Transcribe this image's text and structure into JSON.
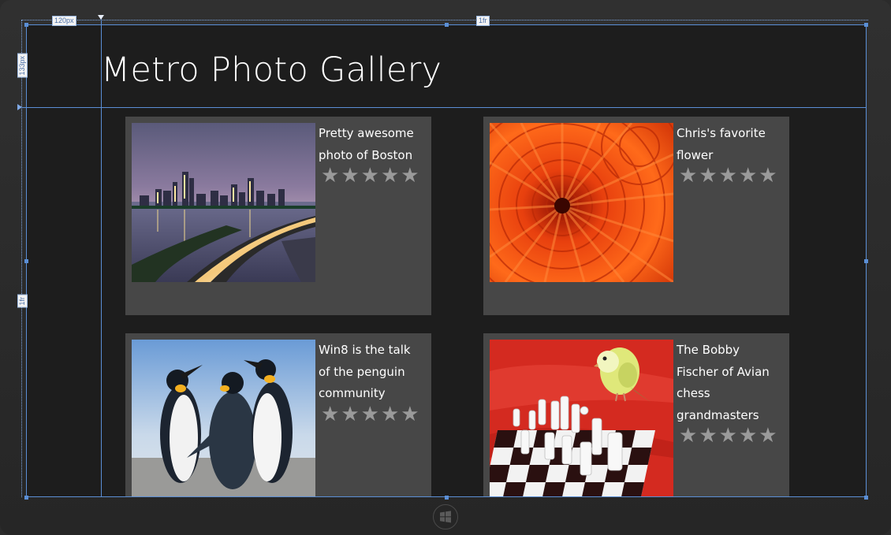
{
  "app": {
    "title": "Metro Photo Gallery"
  },
  "designer": {
    "col1_size": "120px",
    "col2_size": "1fr",
    "row1_size": "133px",
    "row2_size": "1fr",
    "guide_color": "#5b8fd6"
  },
  "gallery": {
    "items": [
      {
        "caption": "Pretty awesome photo of Boston",
        "photo": "boston-skyline-night",
        "rating_stars": [
          "★",
          "★",
          "★",
          "★",
          "★"
        ]
      },
      {
        "caption": "Chris's favorite flower",
        "photo": "orange-dahlia-flower",
        "rating_stars": [
          "★",
          "★",
          "★",
          "★",
          "★"
        ]
      },
      {
        "caption": "Win8 is the talk of the penguin community",
        "photo": "king-penguins",
        "rating_stars": [
          "★",
          "★",
          "★",
          "★",
          "★"
        ]
      },
      {
        "caption": "The Bobby Fischer of Avian chess grandmasters",
        "photo": "budgie-chess-board",
        "rating_stars": [
          "★",
          "★",
          "★",
          "★",
          "★"
        ]
      }
    ]
  },
  "icons": {
    "start": "windows-start-icon"
  },
  "colors": {
    "tile_bg": "#474747",
    "screen_bg": "#1d1d1d",
    "star": "#9a9a9a"
  }
}
